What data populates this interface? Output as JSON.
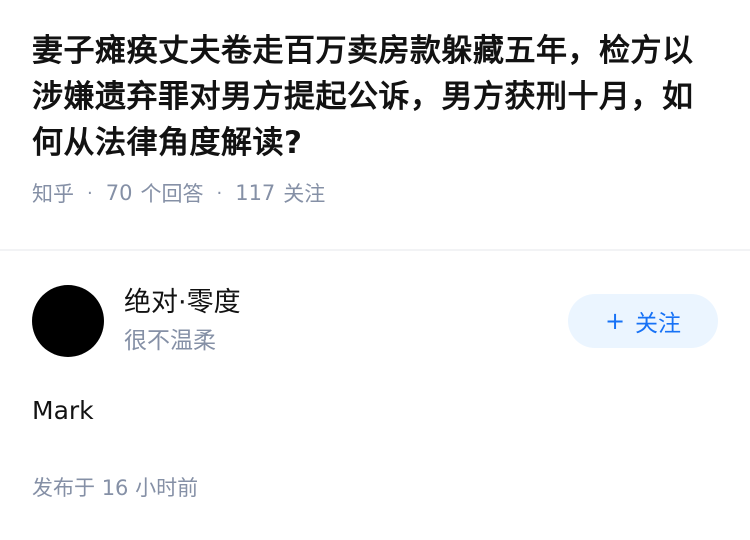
{
  "question": {
    "title": "妻子瘫痪丈夫卷走百万卖房款躲藏五年，检方以涉嫌遗弃罪对男方提起公诉，男方获刑十月，如何从法律角度解读?",
    "source": "知乎",
    "separator": "·",
    "answer_count": "70",
    "answer_unit": "个回答",
    "follow_count": "117",
    "follow_unit": "关注"
  },
  "answer": {
    "author_name": "绝对·零度",
    "author_bio": "很不温柔",
    "follow_button": {
      "icon": "+",
      "label": "关注"
    },
    "content": "Mark",
    "time_prefix": "发布于",
    "time_value": "16 小时前"
  },
  "colors": {
    "title": "#121212",
    "meta": "#8590a6",
    "follow_bg": "#ebf5ff",
    "follow_text": "#1772f6",
    "avatar": "#000000"
  }
}
